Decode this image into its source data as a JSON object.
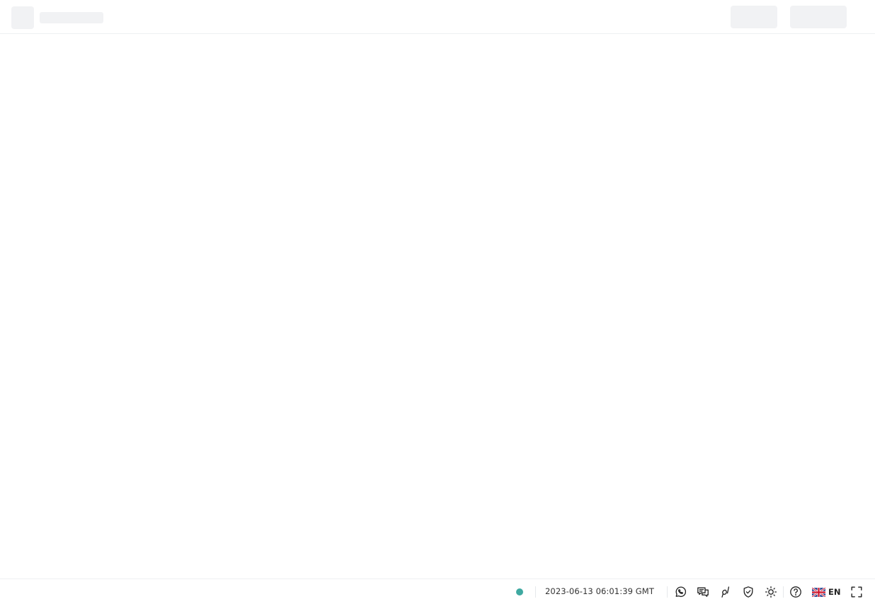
{
  "footer": {
    "connection_status_color": "#3fa9a1",
    "server_time": "2023-06-13 06:01:39 GMT",
    "icons": [
      "whatsapp-icon",
      "live-chat-icon",
      "deriv-go-icon",
      "responsible-trading-icon",
      "theme-toggle-icon",
      "help-icon",
      "fullscreen-icon"
    ],
    "language": {
      "code": "EN",
      "flag": "uk-flag-icon"
    }
  }
}
